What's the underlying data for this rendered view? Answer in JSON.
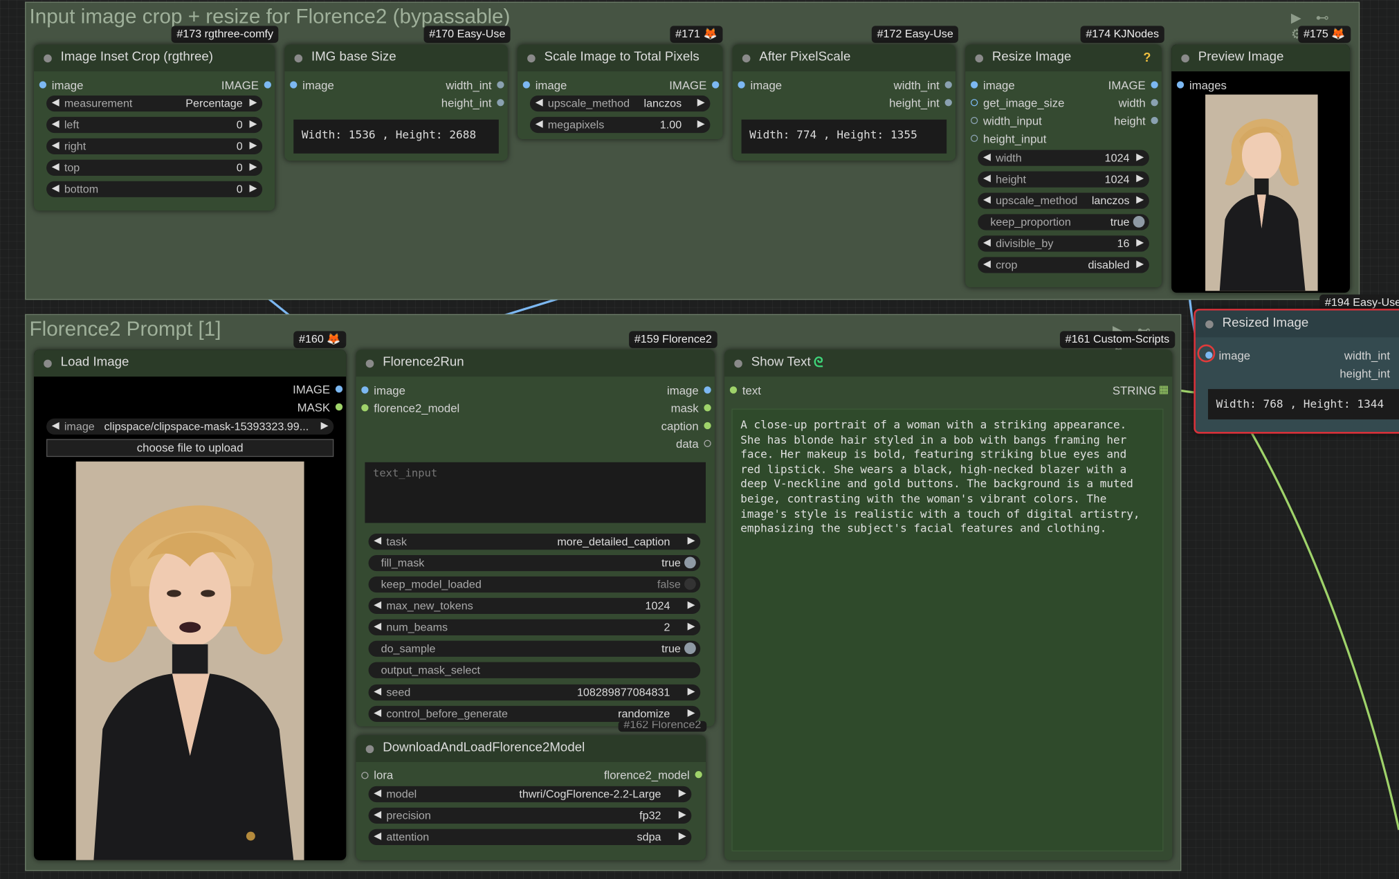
{
  "groups": {
    "top": {
      "title": "Input image crop + resize for Florence2 (bypassable)",
      "controls": "▶ ⊷ ⚙"
    },
    "bottom": {
      "title": "Florence2 Prompt [1]",
      "controls": "▶ ⊷ ⚙"
    }
  },
  "nodes": {
    "inset_crop": {
      "badge": "#173 rgthree-comfy",
      "title": "Image Inset Crop (rgthree)",
      "in_image": "image",
      "out_image": "IMAGE",
      "w_measurement_label": "measurement",
      "w_measurement_value": "Percentage",
      "w_left_label": "left",
      "w_left_value": "0",
      "w_right_label": "right",
      "w_right_value": "0",
      "w_top_label": "top",
      "w_top_value": "0",
      "w_bottom_label": "bottom",
      "w_bottom_value": "0"
    },
    "img_base": {
      "badge": "#170 Easy-Use",
      "title": "IMG base Size",
      "in_image": "image",
      "out_w": "width_int",
      "out_h": "height_int",
      "display": "Width: 1536 , Height: 2688"
    },
    "scale_total": {
      "badge": "#171 🦊",
      "title": "Scale Image to Total Pixels",
      "in_image": "image",
      "out_image": "IMAGE",
      "w_method_label": "upscale_method",
      "w_method_value": "lanczos",
      "w_mp_label": "megapixels",
      "w_mp_value": "1.00"
    },
    "after_pixel": {
      "badge": "#172 Easy-Use",
      "title": "After PixelScale",
      "in_image": "image",
      "out_w": "width_int",
      "out_h": "height_int",
      "display": "Width: 774 , Height: 1355"
    },
    "resize": {
      "badge": "#174 KJNodes",
      "title": "Resize Image",
      "help": "?",
      "in_image": "image",
      "in_get": "get_image_size",
      "in_w": "width_input",
      "in_h": "height_input",
      "out_image": "IMAGE",
      "out_w": "width",
      "out_h": "height",
      "w_width_label": "width",
      "w_width_value": "1024",
      "w_height_label": "height",
      "w_height_value": "1024",
      "w_method_label": "upscale_method",
      "w_method_value": "lanczos",
      "w_keep_label": "keep_proportion",
      "w_keep_value": "true",
      "w_div_label": "divisible_by",
      "w_div_value": "16",
      "w_crop_label": "crop",
      "w_crop_value": "disabled"
    },
    "preview": {
      "badge": "#175 🦊",
      "title": "Preview Image",
      "in_images": "images"
    },
    "resized": {
      "badge": "#194 Easy-Use",
      "title": "Resized Image",
      "in_image": "image",
      "out_w": "width_int",
      "out_h": "height_int",
      "display": "Width: 768 , Height: 1344"
    },
    "load_image": {
      "badge": "#160 🦊",
      "title": "Load Image",
      "out_image": "IMAGE",
      "out_mask": "MASK",
      "w_image_label": "image",
      "w_image_value": "clipspace/clipspace-mask-15393323.99...",
      "upload_label": "choose file to upload"
    },
    "florence_run": {
      "badge": "#159 Florence2",
      "title": "Florence2Run",
      "in_image": "image",
      "in_model": "florence2_model",
      "out_image": "image",
      "out_mask": "mask",
      "out_caption": "caption",
      "out_data": "data",
      "text_placeholder": "text_input",
      "w_task_label": "task",
      "w_task_value": "more_detailed_caption",
      "w_fill_label": "fill_mask",
      "w_fill_value": "true",
      "w_keep_label": "keep_model_loaded",
      "w_keep_value": "false",
      "w_tokens_label": "max_new_tokens",
      "w_tokens_value": "1024",
      "w_beams_label": "num_beams",
      "w_beams_value": "2",
      "w_sample_label": "do_sample",
      "w_sample_value": "true",
      "w_mask_sel_label": "output_mask_select",
      "w_seed_label": "seed",
      "w_seed_value": "108289877084831",
      "w_ctrl_label": "control_before_generate",
      "w_ctrl_value": "randomize"
    },
    "download_model": {
      "badge": "#162 Florence2",
      "title": "DownloadAndLoadFlorence2Model",
      "in_lora": "lora",
      "out_model": "florence2_model",
      "w_model_label": "model",
      "w_model_value": "thwri/CogFlorence-2.2-Large",
      "w_prec_label": "precision",
      "w_prec_value": "fp32",
      "w_attn_label": "attention",
      "w_attn_value": "sdpa"
    },
    "show_text": {
      "badge": "#161 Custom-Scripts",
      "title": "Show Text",
      "in_text": "text",
      "out_string": "STRING",
      "content": "A close-up portrait of a woman with a striking appearance.\nShe has blonde hair styled in a bob with bangs framing her\nface. Her makeup is bold, featuring striking blue eyes and\nred lipstick. She wears a black, high-necked blazer with a\ndeep V-neckline and gold buttons. The background is a muted\nbeige, contrasting with the woman's vibrant colors. The\nimage's style is realistic with a touch of digital artistry,\nemphasizing the subject's facial features and clothing."
    }
  },
  "colors": {
    "link_image": "#7cb8f2",
    "link_string": "#9fd36a",
    "highlight": "#e03b3b"
  }
}
